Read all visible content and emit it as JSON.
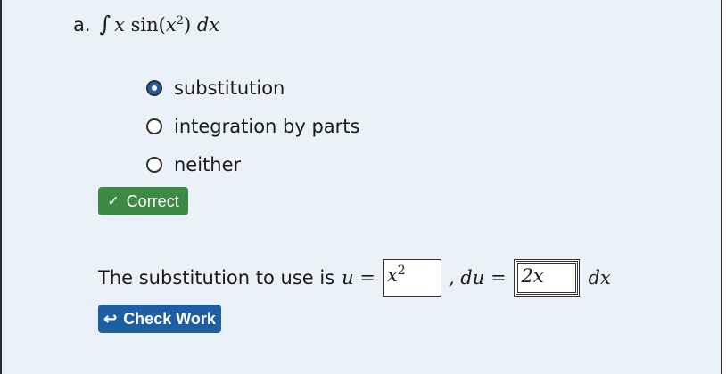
{
  "problem": {
    "label": "a.",
    "integral_symbol": "∫",
    "var_x": "x",
    "func": "sin",
    "open": "(",
    "inner_x": "x",
    "exponent": "2",
    "close": ")",
    "dx": "dx"
  },
  "options": [
    {
      "label": "substitution",
      "selected": true
    },
    {
      "label": "integration by parts",
      "selected": false
    },
    {
      "label": "neither",
      "selected": false
    }
  ],
  "feedback": {
    "check_icon": "✓",
    "label": "Correct",
    "color": "#3d8a45"
  },
  "substitution": {
    "prefix": "The substitution to use is",
    "u_eq": "u =",
    "u_answer_base": "x",
    "u_answer_exp": "2",
    "du_eq": ", du =",
    "du_answer": "2x",
    "dx_suffix": "dx"
  },
  "check_button": {
    "icon": "↩",
    "label": "Check Work",
    "color": "#1e5fa4"
  }
}
